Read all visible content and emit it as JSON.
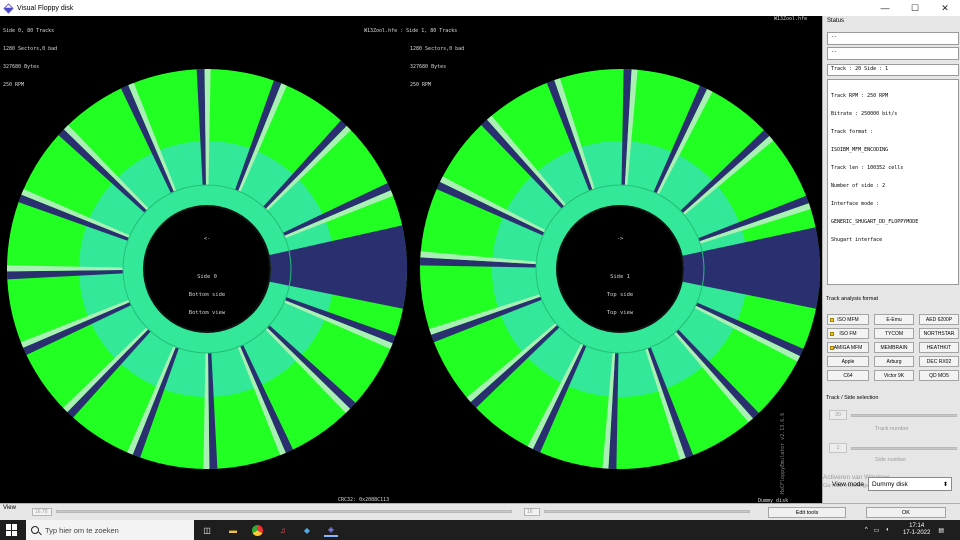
{
  "window": {
    "title": "Visual Floppy disk"
  },
  "info": {
    "left_lines": [
      "Side 0, 80 Tracks",
      "1280 Sectors,0 bad",
      "327680 Bytes",
      "250 RPM"
    ],
    "center_header": "W13Zool.hfe : Side 1, 80 Tracks",
    "center_lines": [
      "1280 Sectors,0 bad",
      "327680 Bytes",
      "250 RPM"
    ],
    "right_header": "W13Zool.hfe",
    "crc": "CRC32: 0x2088C113",
    "dummy": "Dummy disk",
    "version": "HxCFloppyEmulator v2.13.6.6"
  },
  "disks": {
    "left": {
      "arrow": "<-",
      "caption": [
        "Side 0",
        "Bottom side",
        "Bottom view"
      ]
    },
    "right": {
      "arrow": "->",
      "caption": [
        "Side 1",
        "Top side",
        "Top view"
      ]
    },
    "colors": {
      "sector": "#22ff22",
      "mid": "#33e899",
      "gap": "#2a2f70",
      "light": "#aaf0b4",
      "hub": "#111111"
    }
  },
  "status": {
    "title": "Status",
    "field1": "--",
    "field2": "--",
    "track_side": "Track : 20 Side : 1",
    "details": [
      "Track RPM : 250 RPM",
      "Bitrate : 250000 bit/s",
      "Track format :",
      "ISOIBM_MFM_ENCODING",
      "Track len : 100352 cells",
      "Number of side : 2",
      "Interface mode :",
      "GENERIC_SHUGART_DD_FLOPPYMODE",
      "Shugart interface"
    ]
  },
  "track_analysis": {
    "title": "Track analysis format",
    "buttons": [
      "ISO MFM",
      "E-Emu",
      "AED 6200P",
      "ISO FM",
      "TYCOM",
      "NORTHSTAR",
      "AMIGA MFM",
      "MEMBRAIN",
      "HEATHKIT",
      "Apple",
      "Arburg",
      "DEC RX02",
      "C64",
      "Victor 9K",
      "QD MO5"
    ],
    "active": [
      "ISO MFM",
      "ISO FM",
      "AMIGA MFM"
    ]
  },
  "track_side_selection": {
    "title": "Track / Side selection",
    "track_value": "20",
    "track_label": "Track number",
    "side_value": "1",
    "side_label": "Side number"
  },
  "view_mode": {
    "label": "View mode",
    "value": "Dummy disk"
  },
  "watermark": {
    "line1": "Activeren van Windows",
    "line2": "Ga naar Instellingen"
  },
  "view_bar": {
    "label": "View",
    "field1": "16.70",
    "field2": "16",
    "edit_tools": "Edit tools",
    "ok": "OK"
  },
  "taskbar": {
    "search_placeholder": "Typ hier om te zoeken",
    "time": "17:14",
    "date": "17-1-2022"
  }
}
